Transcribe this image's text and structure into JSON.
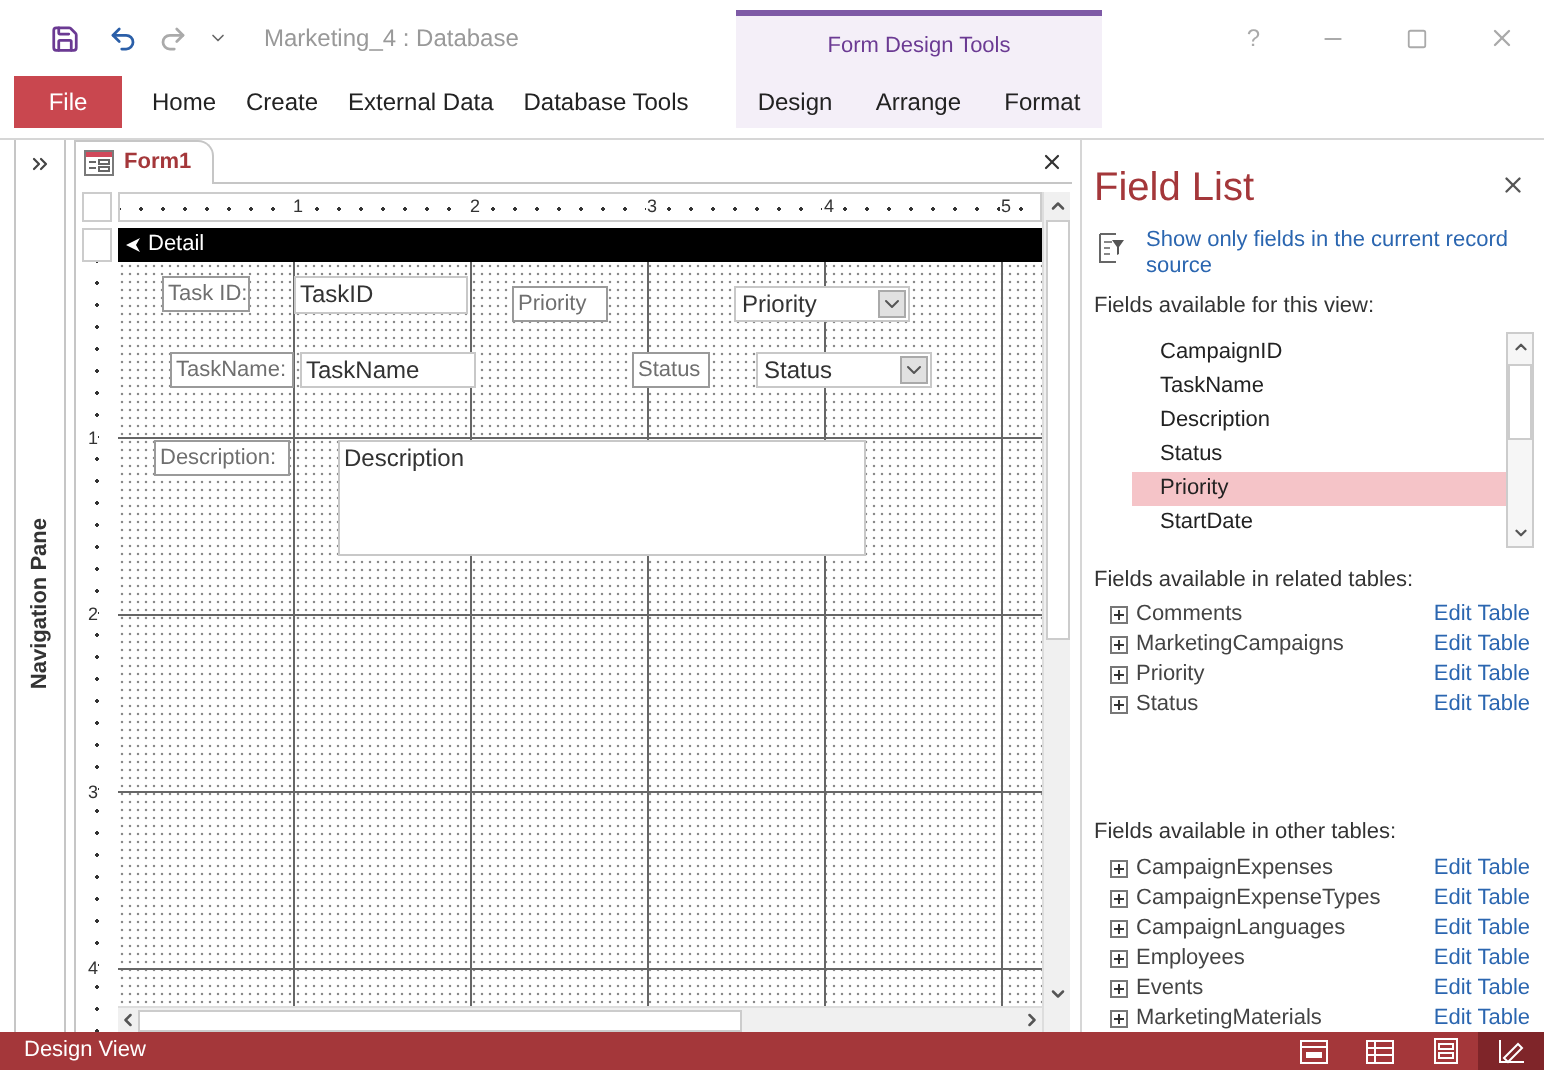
{
  "window": {
    "title": "Marketing_4 : Database",
    "contextual_group": "Form Design Tools",
    "help": "?"
  },
  "ribbon_tabs": [
    {
      "label": "File",
      "kind": "file"
    },
    {
      "label": "Home",
      "kind": "tab"
    },
    {
      "label": "Create",
      "kind": "tab"
    },
    {
      "label": "External Data",
      "kind": "tab"
    },
    {
      "label": "Database Tools",
      "kind": "tab"
    },
    {
      "label": "Design",
      "kind": "contextual"
    },
    {
      "label": "Arrange",
      "kind": "contextual"
    },
    {
      "label": "Format",
      "kind": "contextual"
    }
  ],
  "navigation_pane": {
    "label": "Navigation Pane"
  },
  "document_tab": {
    "title": "Form1"
  },
  "ruler": {
    "horizontal": [
      "1",
      "2",
      "3",
      "4",
      "5"
    ],
    "vertical": [
      "1",
      "2",
      "3",
      "4"
    ]
  },
  "section": {
    "title": "Detail"
  },
  "controls": [
    {
      "kind": "label",
      "text": "Task ID:"
    },
    {
      "kind": "textbox",
      "text": "TaskID"
    },
    {
      "kind": "label",
      "text": "Priority"
    },
    {
      "kind": "combobox",
      "text": "Priority"
    },
    {
      "kind": "label",
      "text": "TaskName:"
    },
    {
      "kind": "textbox",
      "text": "TaskName"
    },
    {
      "kind": "label",
      "text": "Status"
    },
    {
      "kind": "combobox",
      "text": "Status"
    },
    {
      "kind": "label",
      "text": "Description:"
    },
    {
      "kind": "textarea",
      "text": "Description"
    }
  ],
  "field_list": {
    "title": "Field List",
    "show_only_link": "Show only fields in the current record source",
    "view_heading": "Fields available for this view:",
    "view_fields": [
      {
        "name": "CampaignID",
        "selected": false
      },
      {
        "name": "TaskName",
        "selected": false
      },
      {
        "name": "Description",
        "selected": false
      },
      {
        "name": "Status",
        "selected": false
      },
      {
        "name": "Priority",
        "selected": true
      },
      {
        "name": "StartDate",
        "selected": false
      }
    ],
    "related_heading": "Fields available in related tables:",
    "related_tables": [
      {
        "name": "Comments",
        "action": "Edit Table"
      },
      {
        "name": "MarketingCampaigns",
        "action": "Edit Table"
      },
      {
        "name": "Priority",
        "action": "Edit Table"
      },
      {
        "name": "Status",
        "action": "Edit Table"
      }
    ],
    "other_heading": "Fields available in other tables:",
    "other_tables": [
      {
        "name": "CampaignExpenses",
        "action": "Edit Table"
      },
      {
        "name": "CampaignExpenseTypes",
        "action": "Edit Table"
      },
      {
        "name": "CampaignLanguages",
        "action": "Edit Table"
      },
      {
        "name": "Employees",
        "action": "Edit Table"
      },
      {
        "name": "Events",
        "action": "Edit Table"
      },
      {
        "name": "MarketingMaterials",
        "action": "Edit Table"
      }
    ]
  },
  "status_bar": {
    "text": "Design View",
    "views": [
      {
        "kind": "form",
        "selected": false
      },
      {
        "kind": "datasheet",
        "selected": false
      },
      {
        "kind": "layout",
        "selected": false
      },
      {
        "kind": "design",
        "selected": true
      }
    ]
  }
}
